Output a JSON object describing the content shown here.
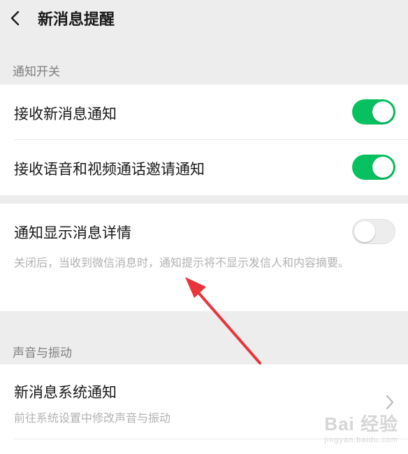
{
  "header": {
    "title": "新消息提醒",
    "back_icon": "chevron-left-icon"
  },
  "sections": {
    "notification_switch": {
      "label": "通知开关",
      "items": [
        {
          "title": "接收新消息通知",
          "enabled": true
        },
        {
          "title": "接收语音和视频通话邀请通知",
          "enabled": true
        }
      ]
    },
    "detail": {
      "title": "通知显示消息详情",
      "enabled": false,
      "description": "关闭后，当收到微信消息时，通知提示将不显示发信人和内容摘要。"
    },
    "sound": {
      "label": "声音与振动",
      "item": {
        "title": "新消息系统通知",
        "subtitle": "前往系统设置中修改声音与振动"
      }
    }
  },
  "watermark": {
    "brand": "Bai 经验",
    "site": "jingyan.baidu.com"
  },
  "colors": {
    "toggle_on": "#07c160",
    "annotation_arrow": "#e8353a"
  }
}
